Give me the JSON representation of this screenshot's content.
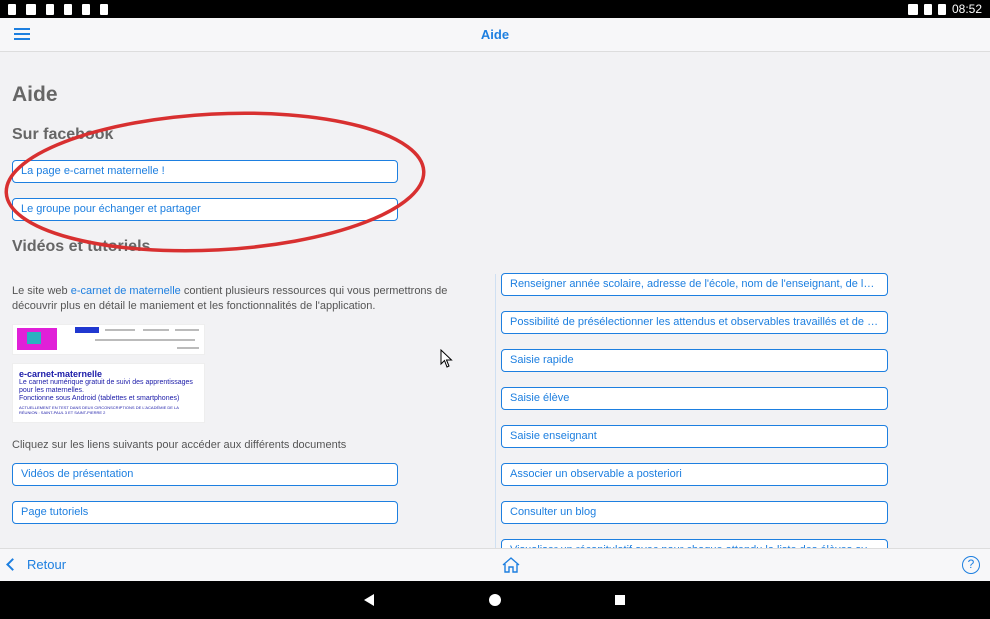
{
  "statusbar": {
    "time": "08:52"
  },
  "nav": {
    "title": "Aide"
  },
  "page": {
    "heading": "Aide",
    "facebook_heading": "Sur facebook",
    "facebook_links": [
      "La page e-carnet maternelle !",
      "Le groupe pour échanger et partager"
    ],
    "videos_heading": "Vidéos et tutoriels",
    "intro_before": "Le site web ",
    "intro_link": "e-carnet de maternelle",
    "intro_after": " contient plusieurs ressources qui vous permettrons de découvrir plus en détail le maniement et les fonctionnalités de l'application.",
    "thumb_title": "e-carnet-maternelle",
    "thumb_line1": "Le carnet numérique gratuit de suivi des apprentissages pour les maternelles.",
    "thumb_line2": "Fonctionne sous Android (tablettes et smartphones)",
    "thumb_small": "ACTUELLEMENT EN TEST DANS DEUX CIRCONSCRIPTIONS DE L'ACADÉMIE DE LA RÉUNION : SAINT-PAUL 3 ET SAINT-PIERRE 2",
    "instruction": "Cliquez sur les liens suivants pour accéder aux différents documents",
    "doc_links": [
      "Vidéos de présentation",
      "Page tutoriels"
    ],
    "tutorial_links": [
      "Renseigner année scolaire, adresse de l'école, nom de l'enseignant, de la cl...",
      "Possibilité de présélectionner les attendus et observables travaillés et de s...",
      "Saisie rapide",
      "Saisie élève",
      "Saisie enseignant",
      "Associer un observable a posteriori",
      "Consulter un blog",
      "Visualiser un récapitulatif avec pour chaque attendu la liste des élèves ayan..."
    ]
  },
  "bottom": {
    "back_label": "Retour",
    "help_label": "?"
  },
  "colors": {
    "accent": "#1d7fe0",
    "annotation": "#d83030"
  }
}
